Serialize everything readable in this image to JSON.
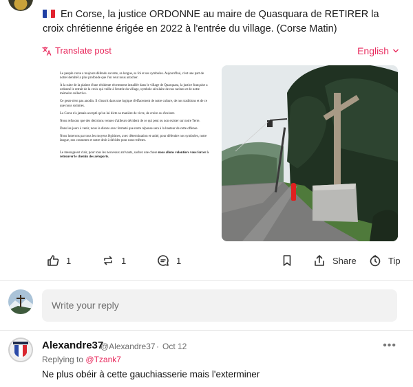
{
  "post": {
    "text": "En Corse, la justice ORDONNE au maire de Quasquara de RETIRER la croix chrétienne érigée en 2022 à l'entrée du village. (Corse Matin)",
    "flag_icon": "flag-france-icon",
    "translate_label": "Translate post",
    "language_label": "English",
    "accent_color": "#e8275b",
    "document": {
      "paragraphs": [
        "Le peuple corse a toujours défendu sa terre, sa langue, sa foi et ses symboles. Aujourd'hui, c'est une part de notre identité la plus profonde que l'on veut nous arracher.",
        "À la suite de la plainte d'une résidente récemment installée dans le village de Quasquara, la justice française a ordonné le retrait de la croix qui veille à l'entrée du village, symbole séculaire de nos racines et de notre mémoire collective.",
        "Ce geste n'est pas anodin. Il s'inscrit dans une logique d'effacement de notre culture, de nos traditions et de ce que nous sommes.",
        "La Corse n'a jamais accepté qu'on lui dicte sa manière de vivre, de croire ou d'exister.",
        "Nous refusons que des décisions venues d'ailleurs décident de ce qui peut ou non exister sur notre Terre.",
        "Dans les jours à venir, nous le disons avec fermeté que notre réponse sera à la hauteur de cette offense.",
        "Nous lutterons par tous les moyens légitimes, avec détermination et unité, pour défendre nos symboles, notre langue, nos coutumes et notre droit à décider pour nous-mêmes."
      ],
      "closing": "Le message est clair, pour tous les nouveaux arrivants, sachez une chose",
      "closing_bold": "nous allons volontiers vous forcer à retrouver le chemin des aéroports."
    }
  },
  "actions": {
    "like_count": "1",
    "repost_count": "1",
    "reply_count": "1",
    "share_label": "Share",
    "tip_label": "Tip"
  },
  "reply": {
    "placeholder": "Write your reply"
  },
  "comment": {
    "author": "Alexandre37",
    "handle": "@Alexandre37",
    "separator": "·",
    "date": "Oct 12",
    "more": "•••",
    "replying_prefix": "Replying to",
    "replying_to": "@Tzank7",
    "text": "Ne plus obéir à cette gauchiasserie mais l'exterminer"
  }
}
